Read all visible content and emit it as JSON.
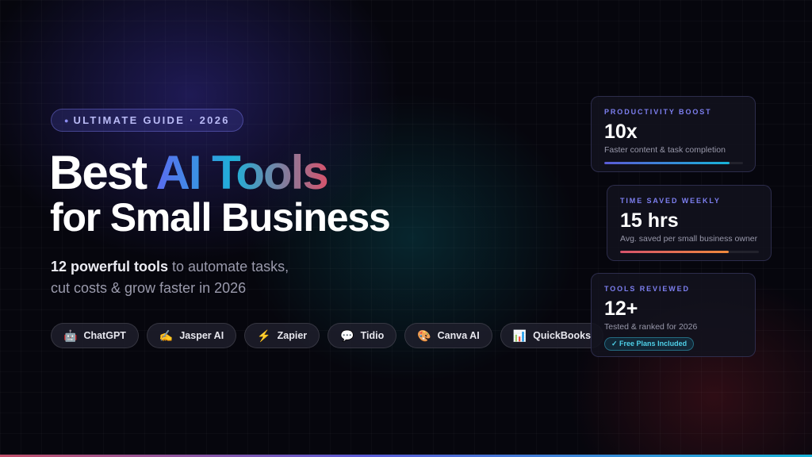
{
  "badge": {
    "text": "ULTIMATE GUIDE · 2026"
  },
  "hero": {
    "title_plain": "Best ",
    "title_gradient": "AI Tools",
    "title_line2": "for Small Business",
    "subtitle_strong": "12 powerful tools",
    "subtitle_rest": " to automate tasks,",
    "subtitle_line2": "cut costs & grow faster in 2026"
  },
  "tools": [
    {
      "icon": "🤖",
      "label": "ChatGPT"
    },
    {
      "icon": "✍️",
      "label": "Jasper AI"
    },
    {
      "icon": "⚡",
      "label": "Zapier"
    },
    {
      "icon": "💬",
      "label": "Tidio"
    },
    {
      "icon": "🎨",
      "label": "Canva AI"
    },
    {
      "icon": "📊",
      "label": "QuickBooks"
    }
  ],
  "stats": [
    {
      "label": "PRODUCTIVITY BOOST",
      "value": "10x",
      "desc": "Faster content & task completion",
      "progress": 0.9
    },
    {
      "label": "TIME SAVED WEEKLY",
      "value": "15 hrs",
      "desc": "Avg. saved per small business owner",
      "progress": 0.78
    },
    {
      "label": "TOOLS REVIEWED",
      "value": "12+",
      "desc": "Tested & ranked for 2026",
      "tag": "✓ Free Plans Included"
    }
  ],
  "colors": {
    "accent_indigo": "#5b5bd6",
    "accent_cyan": "#18b4d8",
    "accent_red": "#d6536c",
    "background": "#06060d"
  }
}
